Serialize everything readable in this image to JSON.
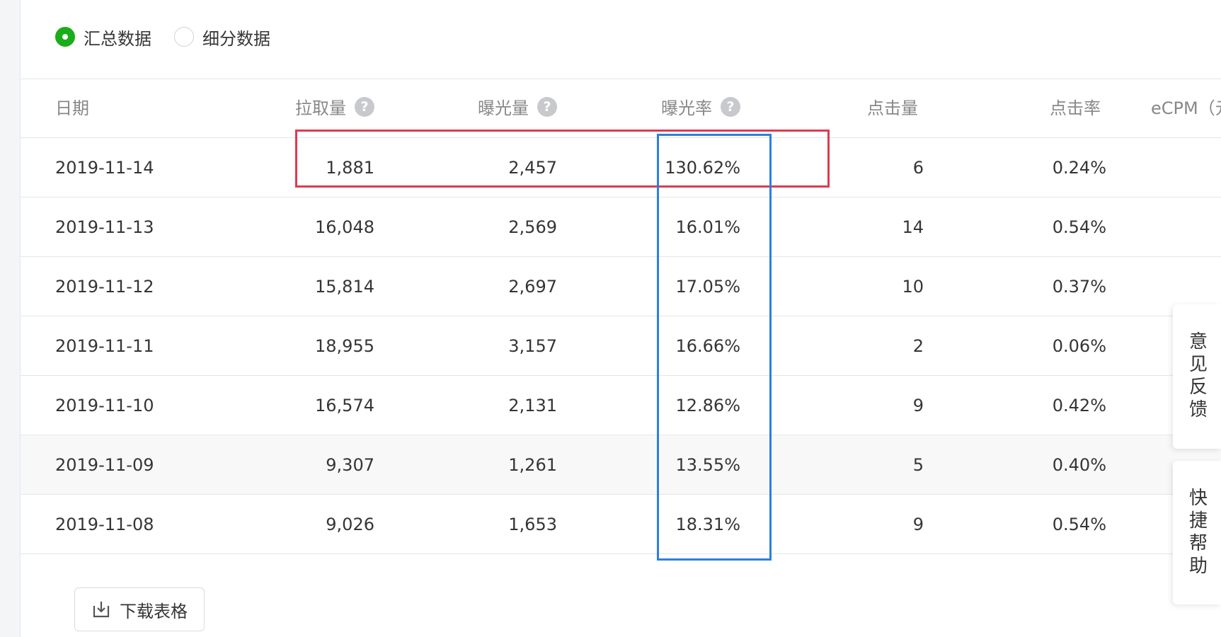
{
  "filters": [
    {
      "label": "汇总数据",
      "checked": true
    },
    {
      "label": "细分数据",
      "checked": false
    }
  ],
  "table": {
    "columns": [
      "日期",
      "拉取量",
      "曝光量",
      "曝光率",
      "点击量",
      "点击率",
      "eCPM（元"
    ],
    "rows": [
      [
        "2019-11-14",
        "1,881",
        "2,457",
        "130.62%",
        "6",
        "0.24%"
      ],
      [
        "2019-11-13",
        "16,048",
        "2,569",
        "16.01%",
        "14",
        "0.54%"
      ],
      [
        "2019-11-12",
        "15,814",
        "2,697",
        "17.05%",
        "10",
        "0.37%"
      ],
      [
        "2019-11-11",
        "18,955",
        "3,157",
        "16.66%",
        "2",
        "0.06%"
      ],
      [
        "2019-11-10",
        "16,574",
        "2,131",
        "12.86%",
        "9",
        "0.42%"
      ],
      [
        "2019-11-09",
        "9,307",
        "1,261",
        "13.55%",
        "5",
        "0.40%"
      ],
      [
        "2019-11-08",
        "9,026",
        "1,653",
        "18.31%",
        "9",
        "0.54%"
      ]
    ]
  },
  "help_glyph": "?",
  "download_label": "下载表格",
  "side_tabs": {
    "feedback": "意见反馈",
    "help": "快捷帮助"
  },
  "colors": {
    "accent": "#1aad19",
    "annotation_red": "#e03a4e",
    "annotation_blue": "#2d7fe0"
  }
}
